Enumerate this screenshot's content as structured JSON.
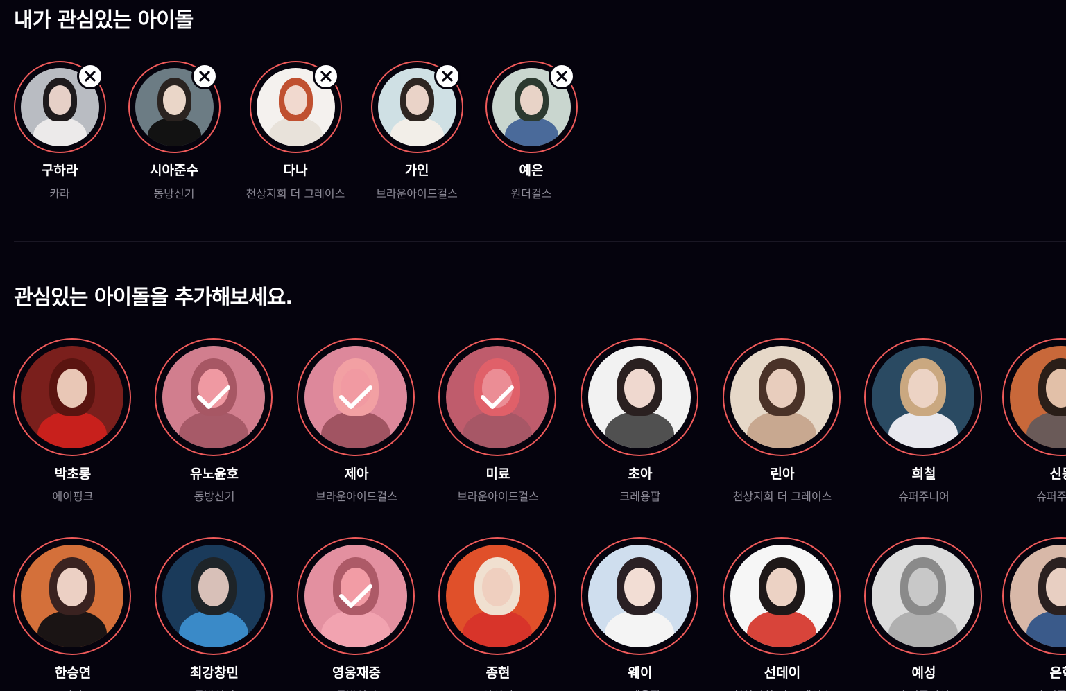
{
  "favorites_section": {
    "title": "내가 관심있는 아이돌",
    "items": [
      {
        "name": "구하라",
        "group": "카라",
        "photo": {
          "bg": "#b9bcc2",
          "hair": "#1e1a1c",
          "skin": "#e6d0c7",
          "outfit": "#eceaea"
        }
      },
      {
        "name": "시아준수",
        "group": "동방신기",
        "photo": {
          "bg": "#6c7c84",
          "hair": "#2a2320",
          "skin": "#ead6c8",
          "outfit": "#121212"
        }
      },
      {
        "name": "다나",
        "group": "천상지희 더 그레이스",
        "photo": {
          "bg": "#f4f1ee",
          "hair": "#c05030",
          "skin": "#f1d9cf",
          "outfit": "#e8e2da"
        }
      },
      {
        "name": "가인",
        "group": "브라운아이드걸스",
        "photo": {
          "bg": "#cfe0e4",
          "hair": "#2e2622",
          "skin": "#ead3c8",
          "outfit": "#f2eee8"
        }
      },
      {
        "name": "예은",
        "group": "원더걸스",
        "photo": {
          "bg": "#c9d6cf",
          "hair": "#2c3a30",
          "skin": "#e8d3c7",
          "outfit": "#4a6a9a"
        }
      }
    ]
  },
  "suggestions_section": {
    "title": "관심있는 아이돌을 추가해보세요.",
    "items": [
      {
        "name": "박초롱",
        "group": "에이핑크",
        "selected": false,
        "photo": {
          "bg": "#7a1f1c",
          "hair": "#5a1410",
          "skin": "#e9c7b6",
          "outfit": "#c8201c"
        }
      },
      {
        "name": "유노윤호",
        "group": "동방신기",
        "selected": true,
        "photo": {
          "bg": "#9a8a92",
          "hair": "#2a2224",
          "skin": "#e7cfc6",
          "outfit": "#2a2a2e"
        }
      },
      {
        "name": "제아",
        "group": "브라운아이드걸스",
        "selected": true,
        "photo": {
          "bg": "#b8a2b2",
          "hair": "#efe2c8",
          "skin": "#ecd2c6",
          "outfit": "#1c1c1e"
        }
      },
      {
        "name": "미료",
        "group": "브라운아이드걸스",
        "selected": true,
        "photo": {
          "bg": "#6a3038",
          "hair": "#c03a30",
          "skin": "#dcb0a4",
          "outfit": "#2a2228"
        }
      },
      {
        "name": "초아",
        "group": "크레용팝",
        "selected": false,
        "photo": {
          "bg": "#f2f2f2",
          "hair": "#2a2020",
          "skin": "#efd8cf",
          "outfit": "#505050"
        }
      },
      {
        "name": "린아",
        "group": "천상지희 더 그레이스",
        "selected": false,
        "photo": {
          "bg": "#e6d8c8",
          "hair": "#4a3228",
          "skin": "#e8cdbd",
          "outfit": "#c8a890"
        }
      },
      {
        "name": "희철",
        "group": "슈퍼주니어",
        "selected": false,
        "photo": {
          "bg": "#2a4a62",
          "hair": "#caa880",
          "skin": "#ecd3c4",
          "outfit": "#e8e8ee"
        }
      },
      {
        "name": "신동",
        "group": "슈퍼주니어",
        "selected": false,
        "photo": {
          "bg": "#c8683a",
          "hair": "#2a1e18",
          "skin": "#e2c0a8",
          "outfit": "#6a5a58"
        }
      },
      {
        "name": "한승연",
        "group": "카라",
        "selected": false,
        "photo": {
          "bg": "#d4703a",
          "hair": "#3a2220",
          "skin": "#ecd0c4",
          "outfit": "#1a1414"
        }
      },
      {
        "name": "최강창민",
        "group": "동방신기",
        "selected": false,
        "photo": {
          "bg": "#1a3a5a",
          "hair": "#1e2428",
          "skin": "#d8c0b8",
          "outfit": "#3a8ac8"
        }
      },
      {
        "name": "영웅재중",
        "group": "동방신기",
        "selected": true,
        "photo": {
          "bg": "#c8b8c0",
          "hair": "#3a2a2a",
          "skin": "#eed8ce",
          "outfit": "#f0eaea"
        }
      },
      {
        "name": "종현",
        "group": "샤이니",
        "selected": false,
        "photo": {
          "bg": "#e0502a",
          "hair": "#f0e0d0",
          "skin": "#efcfbf",
          "outfit": "#d8342a"
        }
      },
      {
        "name": "웨이",
        "group": "크레용팝",
        "selected": false,
        "photo": {
          "bg": "#cfdeee",
          "hair": "#2a2024",
          "skin": "#f2ddd4",
          "outfit": "#f4f4f4"
        }
      },
      {
        "name": "선데이",
        "group": "천상지희 더 그레이스",
        "selected": false,
        "photo": {
          "bg": "#f6f6f6",
          "hair": "#1e1818",
          "skin": "#ecd2c4",
          "outfit": "#d8443a"
        }
      },
      {
        "name": "예성",
        "group": "슈퍼주니어",
        "selected": false,
        "photo": {
          "bg": "#dcdcdc",
          "hair": "#8a8a8a",
          "skin": "#c8c8c8",
          "outfit": "#b0b0b0"
        }
      },
      {
        "name": "은혁",
        "group": "슈퍼주니어",
        "selected": false,
        "photo": {
          "bg": "#d8b8a8",
          "hair": "#2a2020",
          "skin": "#e8cfc2",
          "outfit": "#3a5a8a"
        }
      }
    ]
  }
}
